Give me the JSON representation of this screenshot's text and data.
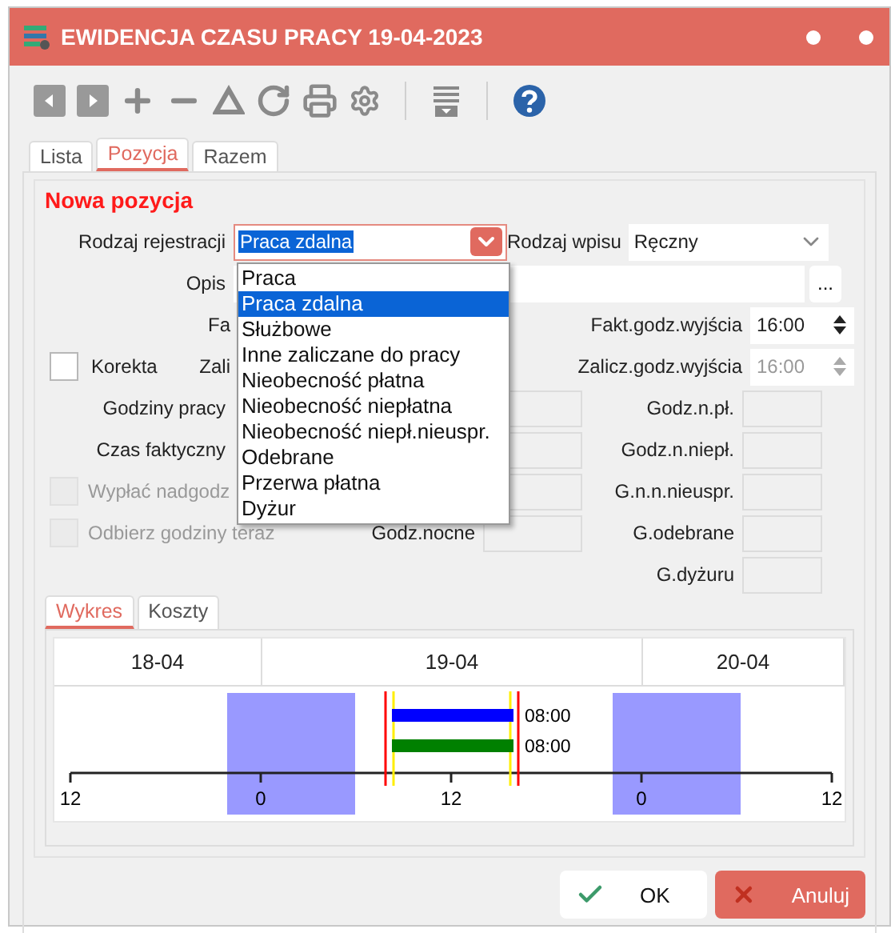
{
  "window": {
    "title": "EWIDENCJA CZASU PRACY 19-04-2023"
  },
  "tabs": [
    {
      "label": "Lista",
      "selected": false
    },
    {
      "label": "Pozycja",
      "selected": true
    },
    {
      "label": "Razem",
      "selected": false
    }
  ],
  "section_title": "Nowa pozycja",
  "rodzaj_rejestracji": {
    "label": "Rodzaj rejestracji",
    "value": "Praca zdalna"
  },
  "rodzaj_wpisu": {
    "label": "Rodzaj wpisu",
    "value": "Ręczny"
  },
  "opis": {
    "label": "Opis",
    "button": "..."
  },
  "fa_label": "Fa",
  "fakt_godz_wyjscia": {
    "label": "Fakt.godz.wyjścia",
    "value": "16:00",
    "disabled": false
  },
  "korekta": {
    "label": "Korekta",
    "checked": false,
    "disabled": false
  },
  "zali_label": "Zali",
  "zalicz_godz_wyjscia": {
    "label": "Zalicz.godz.wyjścia",
    "value": "16:00",
    "disabled": true
  },
  "left_rows": [
    {
      "label": "Godziny pracy"
    },
    {
      "label": "Czas faktyczny"
    }
  ],
  "options": [
    {
      "label": "Wypłać nadgodz",
      "checked": false,
      "disabled": true
    },
    {
      "label": "Odbierz godziny teraz",
      "checked": false,
      "disabled": true
    }
  ],
  "godz_nocne_label": "Godz.nocne",
  "right_rows": [
    {
      "label": "Godz.n.pł."
    },
    {
      "label": "Godz.n.niepł."
    },
    {
      "label": "G.n.n.nieuspr."
    },
    {
      "label": "G.odebrane"
    },
    {
      "label": "G.dyżuru"
    }
  ],
  "dropdown": {
    "items": [
      {
        "label": "Praca",
        "selected": false
      },
      {
        "label": "Praca zdalna",
        "selected": true
      },
      {
        "label": "Służbowe",
        "selected": false
      },
      {
        "label": "Inne zaliczane do pracy",
        "selected": false
      },
      {
        "label": "Nieobecność płatna",
        "selected": false
      },
      {
        "label": "Nieobecność niepłatna",
        "selected": false
      },
      {
        "label": "Nieobecność niepł.nieuspr.",
        "selected": false
      },
      {
        "label": "Odebrane",
        "selected": false
      },
      {
        "label": "Przerwa płatna",
        "selected": false
      },
      {
        "label": "Dyżur",
        "selected": false
      }
    ]
  },
  "chart_tabs": [
    {
      "label": "Wykres",
      "selected": true
    },
    {
      "label": "Koszty",
      "selected": false
    }
  ],
  "timeline": {
    "dates": [
      "18-04",
      "19-04",
      "20-04"
    ],
    "ticks": [
      "12",
      "0",
      "12",
      "0",
      "12"
    ],
    "bars": [
      {
        "label": "08:00",
        "color": "#0000ff"
      },
      {
        "label": "08:00",
        "color": "#008000"
      }
    ]
  },
  "buttons": [
    {
      "label": "OK",
      "kind": "ok"
    },
    {
      "label": "Anuluj",
      "kind": "cancel"
    }
  ]
}
